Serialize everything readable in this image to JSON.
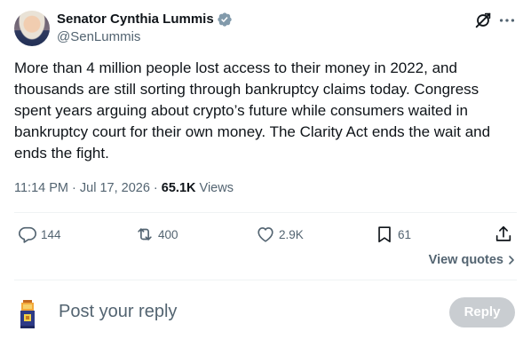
{
  "author": {
    "display_name": "Senator Cynthia Lummis",
    "handle": "@SenLummis",
    "verified": true
  },
  "tweet": {
    "text": "More than 4 million people lost access to their money in 2022, and thousands are still sorting through bankruptcy claims today. Congress spent years arguing about crypto’s future while consumers waited in bankruptcy court for their own money. The Clarity Act ends the wait and ends the fight.",
    "time": "11:14 PM",
    "date": "Jul 17, 2026",
    "views_count": "65.1K",
    "views_label": "Views"
  },
  "actions": {
    "replies": "144",
    "reposts": "400",
    "likes": "2.9K",
    "bookmarks": "61"
  },
  "view_quotes_label": "View quotes",
  "composer": {
    "placeholder": "Post your reply",
    "reply_label": "Reply"
  },
  "colors": {
    "text": "#0f1419",
    "muted": "#536471",
    "divider": "#eff3f4",
    "verified": "#829aab",
    "reply_button_disabled": "#c9cdd1"
  },
  "icons": [
    "verified-badge-icon",
    "grok-icon",
    "more-icon",
    "reply-icon",
    "repost-icon",
    "like-icon",
    "bookmark-icon",
    "share-icon",
    "chevron-right-icon"
  ]
}
